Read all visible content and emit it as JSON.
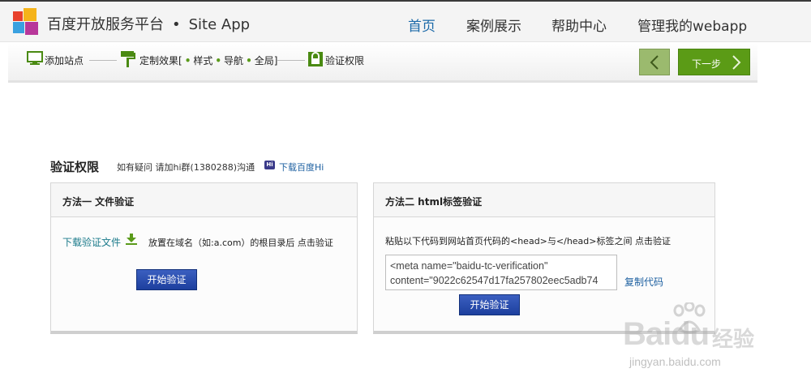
{
  "header": {
    "brand_cn": "百度开放服务平台",
    "brand_sep": "•",
    "brand_en": "Site App",
    "nav": [
      {
        "label": "首页",
        "active": true
      },
      {
        "label": "案例展示",
        "active": false
      },
      {
        "label": "帮助中心",
        "active": false
      },
      {
        "label": "管理我的webapp",
        "active": false
      }
    ]
  },
  "steps": {
    "step1": "添加站点",
    "step2_prefix": "定制效果[",
    "step2_items": [
      "样式",
      "导航",
      "全局"
    ],
    "step2_suffix": "]",
    "step3": "验证权限",
    "next_label": "下一步"
  },
  "section": {
    "title": "验证权限",
    "hint": "如有疑问 请加hi群(1380288)沟通",
    "hi_badge": "Hi",
    "hi_link": "下载百度Hi"
  },
  "method1": {
    "title": "方法一  文件验证",
    "download_link": "下载验证文件",
    "instruction": "放置在域名（如:a.com）的根目录后 点击验证",
    "button": "开始验证"
  },
  "method2": {
    "title": "方法二  html标签验证",
    "instruction": "粘贴以下代码到网站首页代码的<head>与</head>标签之间 点击验证",
    "code_line1": "<meta name=\"baidu-tc-verification\"",
    "code_line2": "content=\"9022c62547d17fa257802eec5adb74",
    "copy_link": "复制代码",
    "button": "开始验证"
  },
  "watermark": {
    "brand": "Baidu",
    "cn": "经验",
    "url": "jingyan.baidu.com"
  },
  "colors": {
    "nav_active": "#1c6aa9",
    "step_green": "#5b9b16",
    "link_blue": "#1c5fa0",
    "button_blue": "#1d3f9e"
  }
}
